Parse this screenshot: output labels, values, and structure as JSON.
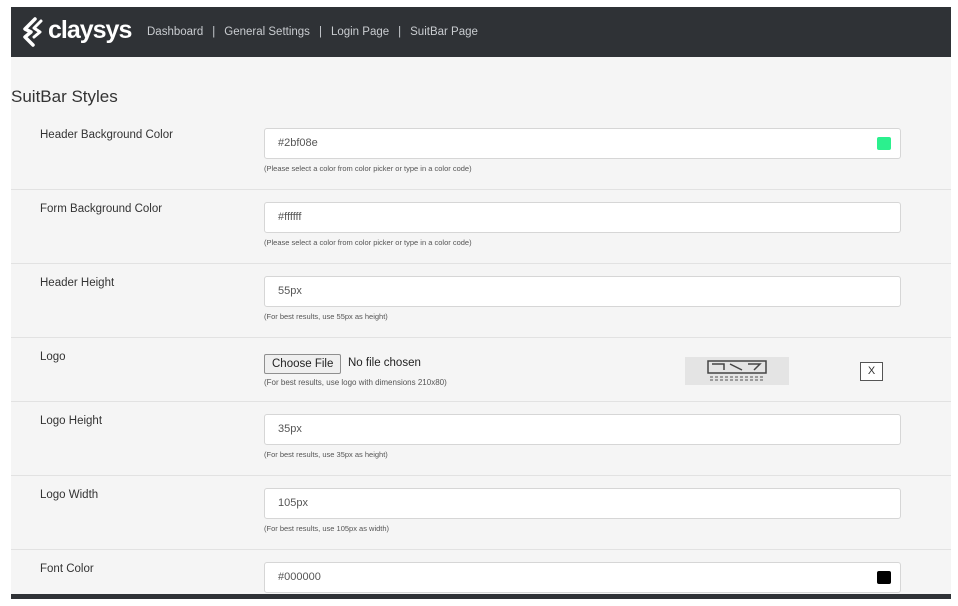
{
  "header": {
    "brand": "claysys",
    "nav": [
      {
        "label": "Dashboard"
      },
      {
        "label": "General Settings"
      },
      {
        "label": "Login Page"
      },
      {
        "label": "SuitBar Page"
      }
    ],
    "nav_separator": "|",
    "bg_color": "#2f3236"
  },
  "page": {
    "title": "SuitBar Styles"
  },
  "fields": {
    "header_bg": {
      "label": "Header Background Color",
      "value": "#2bf08e",
      "hint": "(Please select a color from color picker or type in a color code)",
      "swatch_color": "#2bf08e"
    },
    "form_bg": {
      "label": "Form Background Color",
      "value": "#ffffff",
      "hint": "(Please select a color from color picker or type in a color code)"
    },
    "header_height": {
      "label": "Header Height",
      "value": "55px",
      "hint": "(For best results, use 55px as height)"
    },
    "logo": {
      "label": "Logo",
      "choose_button": "Choose File",
      "file_status": "No file chosen",
      "hint": "(For best results, use logo with dimensions 210x80)",
      "remove_label": "X"
    },
    "logo_height": {
      "label": "Logo Height",
      "value": "35px",
      "hint": "(For best results, use 35px as height)"
    },
    "logo_width": {
      "label": "Logo Width",
      "value": "105px",
      "hint": "(For best results, use 105px as width)"
    },
    "font_color": {
      "label": "Font Color",
      "value": "#000000",
      "swatch_color": "#000000"
    }
  }
}
